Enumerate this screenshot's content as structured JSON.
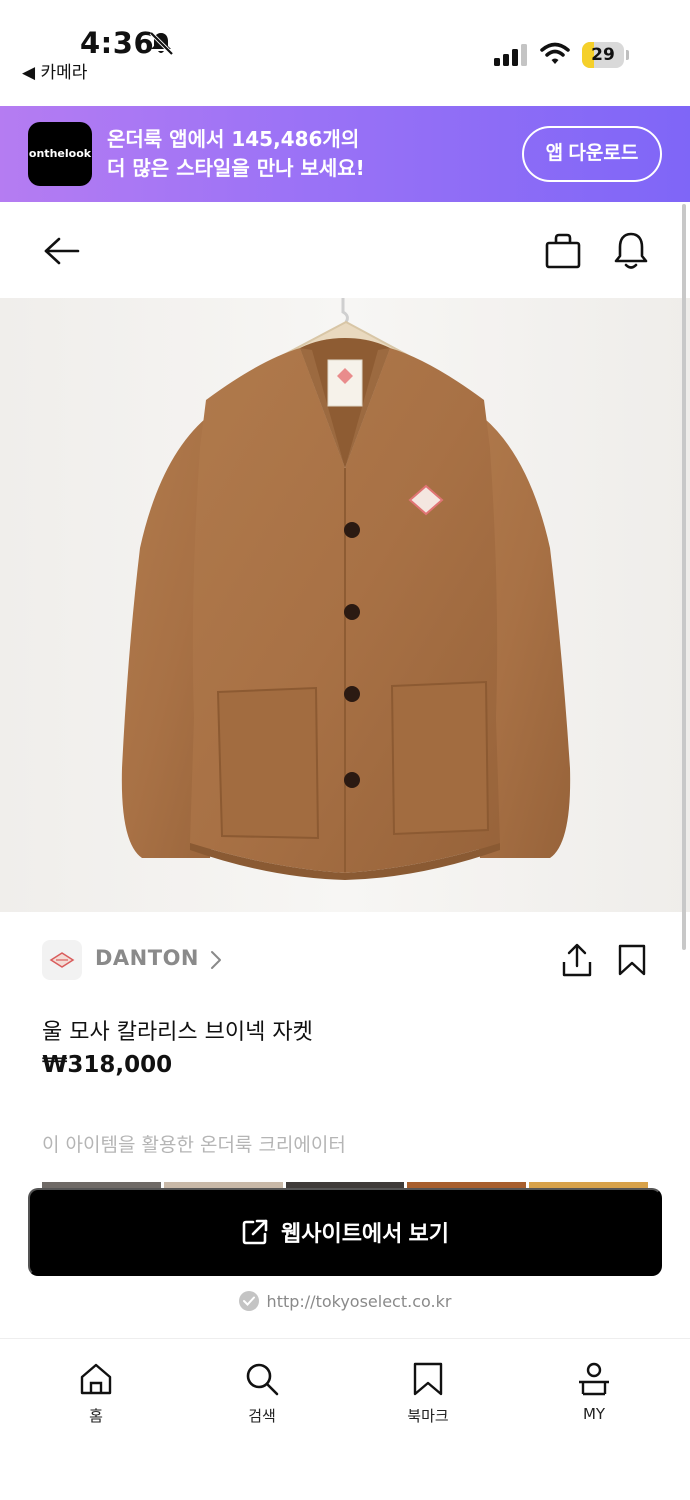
{
  "status_bar": {
    "time": "4:36",
    "back_label": "◀ 카메라",
    "battery_level": "29",
    "battery_fraction": 0.29
  },
  "banner": {
    "logo_text": "onthelook",
    "line1": "온더룩 앱에서 145,486개의",
    "line2": "더 많은 스타일을 만나 보세요!",
    "download_label": "앱 다운로드",
    "gradient_start": "#b57cf2",
    "gradient_end": "#7f66f7"
  },
  "header": {
    "back_icon": "arrow-left-icon",
    "cart_icon": "shopping-bag-icon",
    "notification_icon": "bell-icon"
  },
  "product": {
    "image": "brown wool v-neck collarless jacket on hanger",
    "brand": "DANTON",
    "title": "울 모사 칼라리스 브이넥 자켓",
    "price": "₩318,000",
    "jacket_color": "#a87145"
  },
  "creators": {
    "heading": "이 아이템을 활용한 온더룩 크리에이터"
  },
  "cta": {
    "label": "웹사이트에서 보기",
    "url": "http://tokyoselect.co.kr"
  },
  "bottom_nav": {
    "items": [
      {
        "label": "홈",
        "icon": "home-icon"
      },
      {
        "label": "검색",
        "icon": "search-icon"
      },
      {
        "label": "북마크",
        "icon": "bookmark-icon"
      },
      {
        "label": "MY",
        "icon": "user-icon"
      }
    ]
  }
}
